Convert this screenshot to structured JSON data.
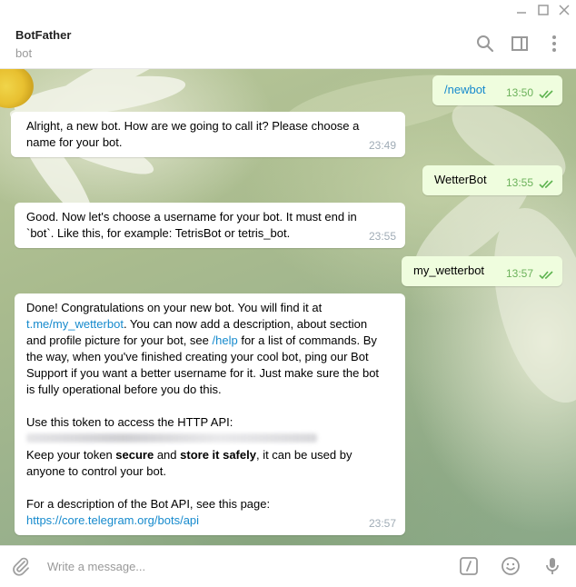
{
  "window": {
    "controls": [
      "minimize-icon",
      "maximize-icon",
      "close-icon"
    ]
  },
  "header": {
    "chat_name": "BotFather",
    "chat_status": "bot",
    "icons": [
      "search-icon",
      "side-panel-icon",
      "more-vertical-icon"
    ]
  },
  "messages": [
    {
      "direction": "out",
      "text": "/newbot",
      "time": "13:50"
    },
    {
      "direction": "in",
      "lines": [
        "Alright, a new bot. How are we going to call it? Please choose a",
        "name for your bot."
      ],
      "time": "23:49"
    },
    {
      "direction": "out",
      "text": "WetterBot",
      "time": "13:55"
    },
    {
      "direction": "in",
      "lines": [
        "Good. Now let's choose a username for your bot. It must end in",
        "`bot`. Like this, for example: TetrisBot or tetris_bot."
      ],
      "time": "23:55"
    },
    {
      "direction": "out",
      "text": "my_wetterbot",
      "time": "13:57"
    },
    {
      "direction": "in",
      "time": "23:57",
      "line1": "Done! Congratulations on your new bot. You will find it at",
      "bot_link": "t.me/my_wetterbot",
      "line2_rest": ". You can now add a description, about section",
      "line3_pre": "and profile picture for your bot, see ",
      "help_cmd": "/help",
      "line3_post": " for a list of commands. By",
      "line4": "the way, when you've finished creating your cool bot, ping our Bot",
      "line5": "Support if you want a better username for it. Just make sure the bot",
      "line6": "is fully operational before you do this.",
      "token_intro": "Use this token to access the HTTP API:",
      "keep_pre": "Keep your token ",
      "keep_secure": "secure",
      "keep_and": " and ",
      "keep_store": "store it safely",
      "keep_post": ", it can be used by",
      "keep_line2": "anyone to control your bot.",
      "api_intro": "For a description of the Bot API, see this page:",
      "api_link": "https://core.telegram.org/bots/api"
    }
  ],
  "composer": {
    "placeholder": "Write a message...",
    "icons": [
      "attach-icon",
      "bot-command-icon",
      "emoji-icon",
      "microphone-icon"
    ]
  },
  "colors": {
    "accent": "#168acd",
    "outgoing_bubble": "#effdde",
    "outgoing_time": "#6cb25b",
    "incoming_time": "#a0acb6"
  }
}
